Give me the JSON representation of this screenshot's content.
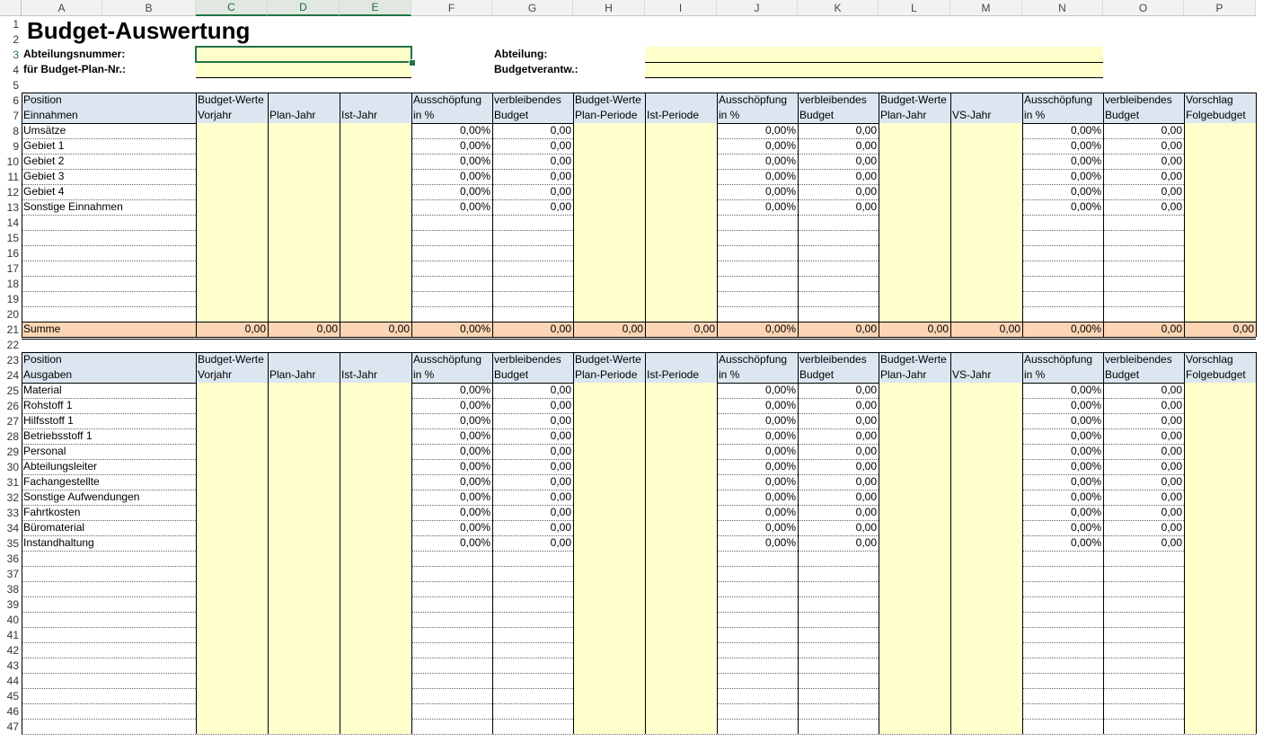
{
  "columns": [
    "A",
    "B",
    "C",
    "D",
    "E",
    "F",
    "G",
    "H",
    "I",
    "J",
    "K",
    "L",
    "M",
    "N",
    "O",
    "P"
  ],
  "title": "Budget-Auswertung",
  "labels": {
    "abteilungsnummer": "Abteilungsnummer:",
    "budget_plan_nr": "für Budget-Plan-Nr.:",
    "abteilung": "Abteilung:",
    "budgetverantw": "Budgetverantw.:"
  },
  "header_row1": {
    "position": "Position",
    "budget_werte": "Budget-Werte",
    "ausschoepfung": "Ausschöpfung",
    "verbleibendes": "verbleibendes",
    "vorschlag": "Vorschlag"
  },
  "header_row2_income": {
    "first": "Einnahmen",
    "vorjahr": "Vorjahr",
    "plan_jahr": "Plan-Jahr",
    "ist_jahr": "Ist-Jahr",
    "in_pct": "in %",
    "budget": "Budget",
    "plan_periode": "Plan-Periode",
    "ist_periode": "Ist-Periode",
    "vs_jahr": "VS-Jahr",
    "folgebudget": "Folgebudget"
  },
  "header_row2_expense": {
    "first": "Ausgaben"
  },
  "income_rows": [
    "Umsätze",
    "Gebiet 1",
    "Gebiet 2",
    "Gebiet 3",
    "Gebiet 4",
    "Sonstige Einnahmen"
  ],
  "expense_rows": [
    "Material",
    "Rohstoff 1",
    "Hilfsstoff 1",
    "Betriebsstoff 1",
    "Personal",
    "Abteilungsleiter",
    "Fachangestellte",
    "Sonstige Aufwendungen",
    "Fahrtkosten",
    "Büromaterial",
    "Instandhaltung"
  ],
  "values": {
    "pct": "0,00%",
    "amount": "0,00"
  },
  "summe": {
    "label": "Summe",
    "values": [
      "0,00",
      "0,00",
      "0,00",
      "0,00%",
      "0,00",
      "0,00",
      "0,00",
      "0,00%",
      "0,00",
      "0,00",
      "0,00",
      "0,00%",
      "0,00",
      "0,00"
    ]
  },
  "colors": {
    "header": "#dce6f1",
    "input": "#ffffcc",
    "sum": "#fcd5b4",
    "accent": "#217346"
  }
}
